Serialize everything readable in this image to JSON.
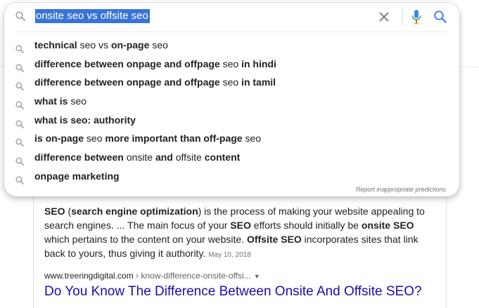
{
  "search": {
    "query": "onsite seo vs offsite seo",
    "suggestions": [
      {
        "parts": [
          {
            "t": "technical",
            "b": true
          },
          {
            "t": " seo vs ",
            "b": false
          },
          {
            "t": "on-page",
            "b": true
          },
          {
            "t": " seo",
            "b": false
          }
        ]
      },
      {
        "parts": [
          {
            "t": "difference between onpage and offpage",
            "b": true
          },
          {
            "t": " seo ",
            "b": false
          },
          {
            "t": "in hindi",
            "b": true
          }
        ]
      },
      {
        "parts": [
          {
            "t": "difference between onpage and offpage",
            "b": true
          },
          {
            "t": " seo ",
            "b": false
          },
          {
            "t": "in tamil",
            "b": true
          }
        ]
      },
      {
        "parts": [
          {
            "t": "what is",
            "b": true
          },
          {
            "t": " seo",
            "b": false
          }
        ]
      },
      {
        "parts": [
          {
            "t": "what is seo: authority",
            "b": true
          }
        ]
      },
      {
        "parts": [
          {
            "t": "is on-page",
            "b": true
          },
          {
            "t": " seo ",
            "b": false
          },
          {
            "t": "more important than off-page",
            "b": true
          },
          {
            "t": " seo",
            "b": false
          }
        ]
      },
      {
        "parts": [
          {
            "t": "difference between",
            "b": true
          },
          {
            "t": " onsite ",
            "b": false
          },
          {
            "t": "and",
            "b": true
          },
          {
            "t": " offsite ",
            "b": false
          },
          {
            "t": "content",
            "b": true
          }
        ]
      },
      {
        "parts": [
          {
            "t": "onpage marketing",
            "b": true
          }
        ]
      }
    ],
    "report_label": "Report inappropriate predictions"
  },
  "result": {
    "snippet_parts": [
      {
        "t": "SEO",
        "b": true
      },
      {
        "t": " (",
        "b": false
      },
      {
        "t": "search engine optimization",
        "b": true
      },
      {
        "t": ") is the process of making your website appealing to search engines. ... The main focus of your ",
        "b": false
      },
      {
        "t": "SEO",
        "b": true
      },
      {
        "t": " efforts should initially be ",
        "b": false
      },
      {
        "t": "onsite SEO",
        "b": true
      },
      {
        "t": " which pertains to the content on your website. ",
        "b": false
      },
      {
        "t": "Offsite SEO",
        "b": true
      },
      {
        "t": " incorporates sites that link back to yours, thus giving it authority. ",
        "b": false
      }
    ],
    "date": "May 10, 2018",
    "url_domain": "www.treeringdigital.com",
    "url_path": " › know-difference-onsite-offsi...",
    "url_caret": "▼",
    "title": "Do You Know The Difference Between Onsite And Offsite SEO?"
  },
  "colors": {
    "link_title": "#1a0dab",
    "query_highlight": "#3874d8",
    "icon_gray": "#9aa0a6",
    "search_blue": "#4285f4",
    "mic_red": "#ea4335"
  },
  "icons": {
    "lead": "search-icon",
    "clear": "close-icon",
    "mic": "microphone-icon",
    "submit": "search-icon",
    "suggestion": "search-icon"
  }
}
